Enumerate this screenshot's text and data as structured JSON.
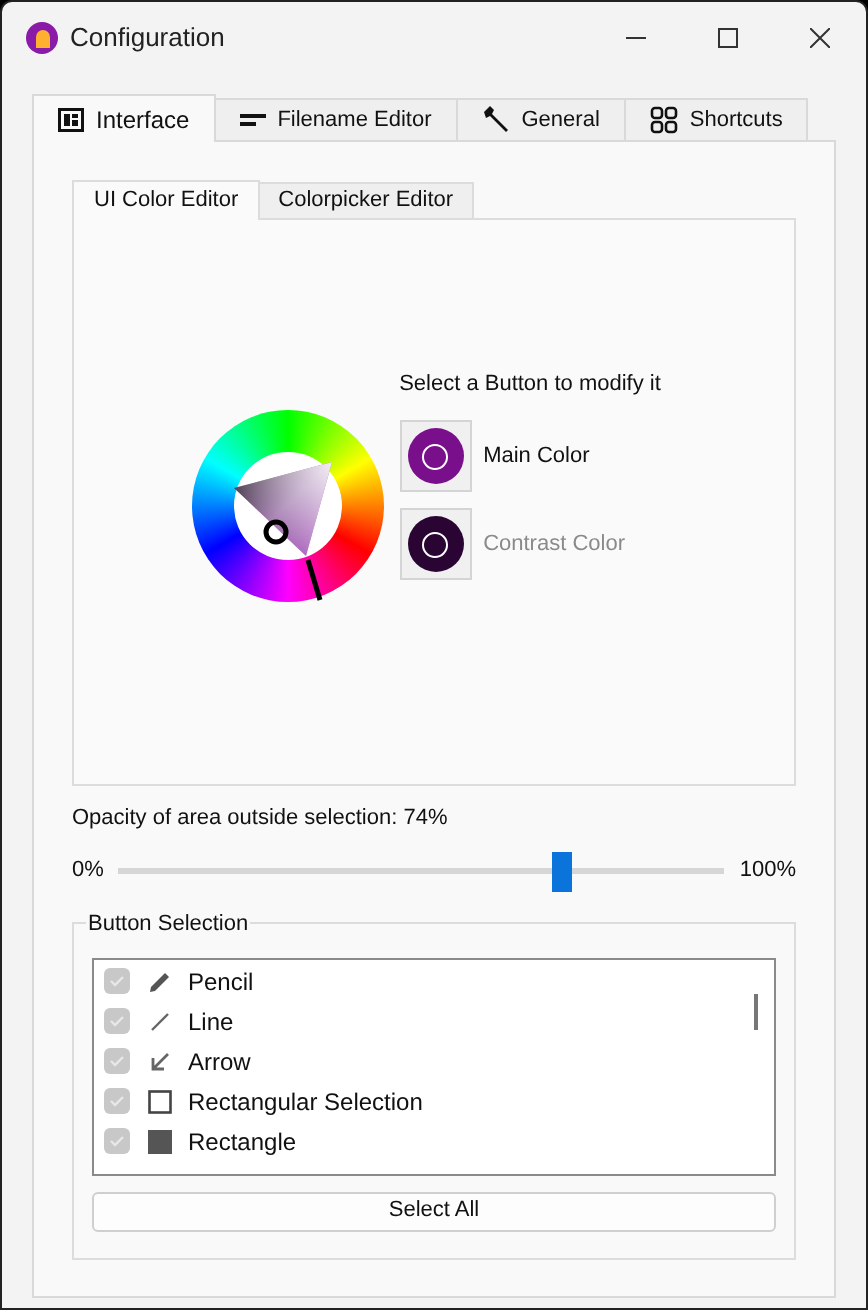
{
  "window": {
    "title": "Configuration"
  },
  "tabs": [
    {
      "label": "Interface",
      "selected": true
    },
    {
      "label": "Filename Editor",
      "selected": false
    },
    {
      "label": "General",
      "selected": false
    },
    {
      "label": "Shortcuts",
      "selected": false
    }
  ],
  "sub_tabs": [
    {
      "label": "UI Color Editor",
      "selected": true
    },
    {
      "label": "Colorpicker Editor",
      "selected": false
    }
  ],
  "color_editor": {
    "hint": "Select a Button to modify it",
    "buttons": [
      {
        "label": "Main Color",
        "color": "#7a0f8c",
        "selected": true
      },
      {
        "label": "Contrast Color",
        "color": "#2a0533",
        "selected": false
      }
    ]
  },
  "opacity": {
    "label": "Opacity of area outside selection: 74%",
    "min_label": "0%",
    "max_label": "100%",
    "level": 0.74
  },
  "button_selection": {
    "title": "Button Selection",
    "items": [
      {
        "label": "Pencil",
        "checked": true
      },
      {
        "label": "Line",
        "checked": true
      },
      {
        "label": "Arrow",
        "checked": true
      },
      {
        "label": "Rectangular Selection",
        "checked": true
      },
      {
        "label": "Rectangle",
        "checked": true
      }
    ],
    "select_all": "Select All"
  }
}
